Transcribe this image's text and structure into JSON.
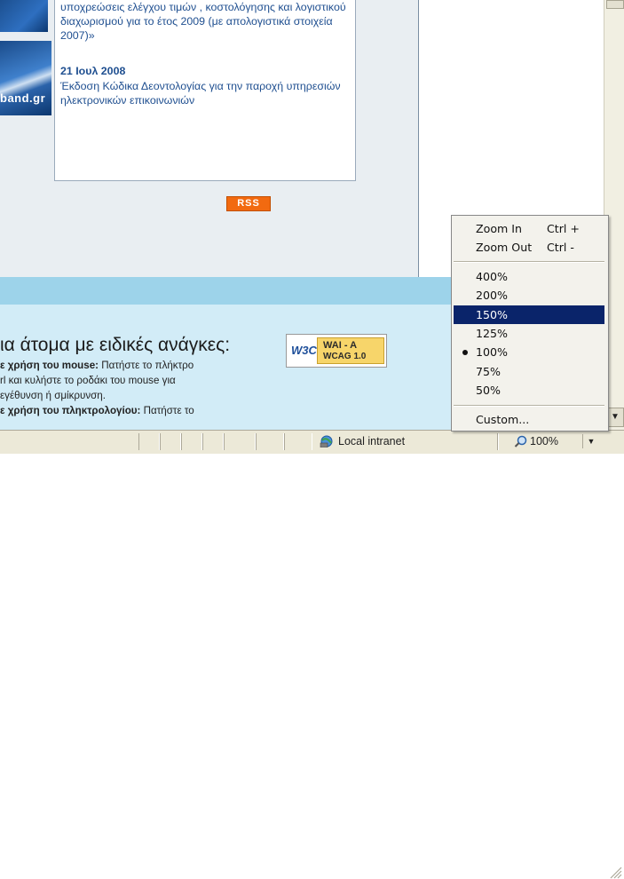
{
  "news": {
    "item1_text": "υποχρεώσεις ελέγχου τιμών , κοστολόγησης και λογιστικού διαχωρισμού για το έτος 2009 (με απολογιστικά στοιχεία 2007)»",
    "item2_date": "21 Ιουλ 2008",
    "item2_text": "Έκδοση Κώδικα Δεοντολογίας για την παροχή υπηρεσιών ηλεκτρονικών επικοινωνιών",
    "rss_label": "RSS"
  },
  "banner": {
    "partial_label": "band.gr"
  },
  "accessibility": {
    "title": "ια άτομα με ειδικές ανάγκες:",
    "line1_bold": "ε χρήση του mouse:",
    "line1_rest": " Πατήστε το πλήκτρο",
    "line2": "rl και κυλήστε το ροδάκι του mouse για",
    "line3": "εγέθυνση ή σμίκρυνση.",
    "line4_bold": "ε χρήση του πληκτρολογίου:",
    "line4_rest": " Πατήστε το",
    "w3c_logo": "W3C",
    "wai_line1": "WAI - A",
    "wai_line2": "WCAG 1.0"
  },
  "statusbar": {
    "zone_label": "Local intranet",
    "zoom_value": "100%",
    "zoom_arrow": "▼"
  },
  "zoom_menu": {
    "zoom_in_label": "Zoom In",
    "zoom_in_shortcut": "Ctrl +",
    "zoom_out_label": "Zoom Out",
    "zoom_out_shortcut": "Ctrl -",
    "levels": [
      "400%",
      "200%",
      "150%",
      "125%",
      "100%",
      "75%",
      "50%"
    ],
    "highlighted_level": "150%",
    "checked_level": "100%",
    "custom_label": "Custom..."
  },
  "colors": {
    "menu_highlight": "#0a246a",
    "link_blue": "#1f4f90",
    "rss_orange": "#f26a10"
  }
}
